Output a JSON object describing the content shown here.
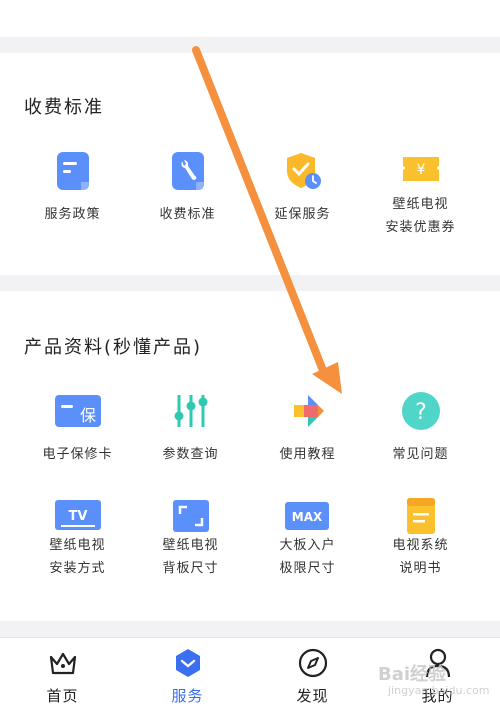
{
  "fee_section": {
    "title": "收费标准",
    "items": [
      {
        "label_lines": [
          "服务政策"
        ],
        "icon": "document-icon"
      },
      {
        "label_lines": [
          "收费标准"
        ],
        "icon": "wrench-icon"
      },
      {
        "label_lines": [
          "延保服务"
        ],
        "icon": "shield-clock-icon"
      },
      {
        "label_lines": [
          "壁纸电视",
          "安装优惠券"
        ],
        "icon": "yen-coupon-icon"
      }
    ]
  },
  "product_section": {
    "title": "产品资料(秒懂产品)",
    "items": [
      {
        "label_lines": [
          "电子保修卡"
        ],
        "icon": "warranty-card-icon",
        "badge": "保"
      },
      {
        "label_lines": [
          "参数查询"
        ],
        "icon": "sliders-icon"
      },
      {
        "label_lines": [
          "使用教程"
        ],
        "icon": "tutorial-icon"
      },
      {
        "label_lines": [
          "常见问题"
        ],
        "icon": "question-icon"
      },
      {
        "label_lines": [
          "壁纸电视",
          "安装方式"
        ],
        "icon": "tv-icon",
        "badge": "TV"
      },
      {
        "label_lines": [
          "壁纸电视",
          "背板尺寸"
        ],
        "icon": "frame-size-icon"
      },
      {
        "label_lines": [
          "大板入户",
          "极限尺寸"
        ],
        "icon": "max-size-icon",
        "badge": "MAX"
      },
      {
        "label_lines": [
          "电视系统",
          "说明书"
        ],
        "icon": "manual-icon"
      }
    ]
  },
  "tabbar": {
    "tabs": [
      {
        "label": "首页",
        "icon": "crown-icon"
      },
      {
        "label": "服务",
        "icon": "service-hex-icon",
        "active": true
      },
      {
        "label": "发现",
        "icon": "compass-icon"
      },
      {
        "label": "我的",
        "icon": "person-icon"
      }
    ]
  },
  "colors": {
    "accent": "#3a6ff2",
    "icon_blue": "#5b8ff9",
    "icon_yellow": "#fbc02d",
    "arrow": "#f5913e"
  },
  "watermark": {
    "main": "Bai经验",
    "sub": "jingyan.baidu.com"
  }
}
